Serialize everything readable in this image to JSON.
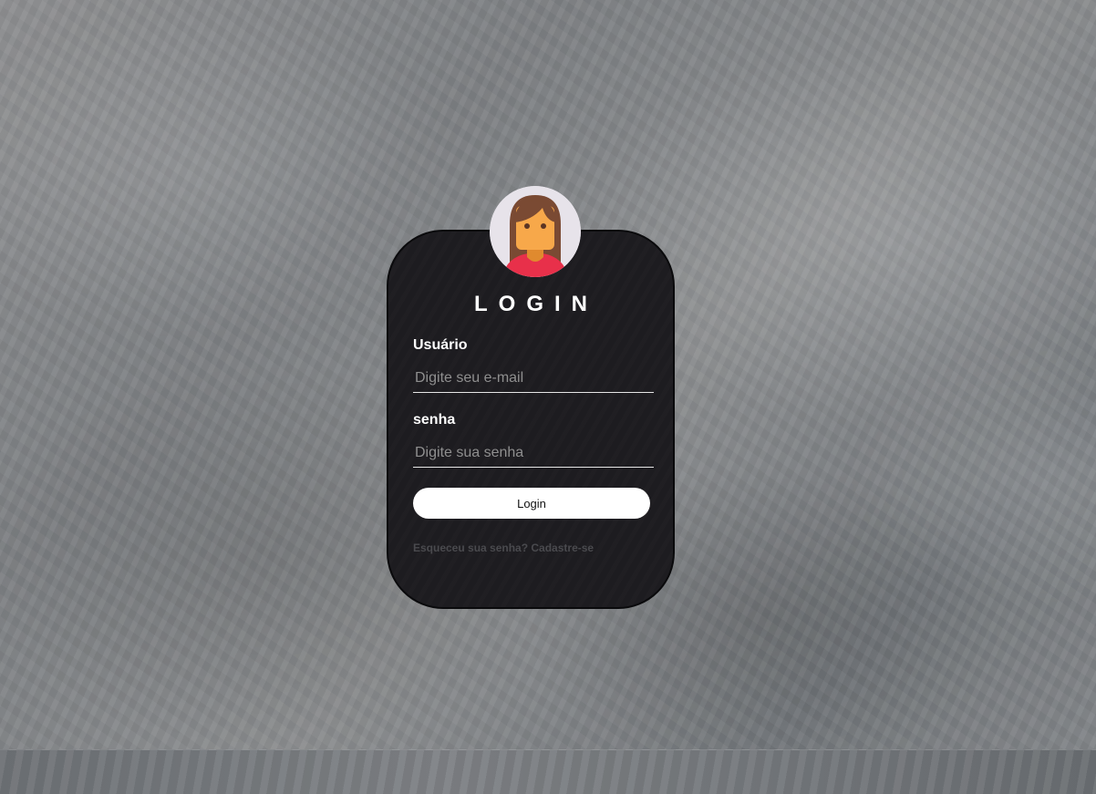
{
  "background": {
    "style": "grey concrete texture"
  },
  "login_card": {
    "avatar": {
      "icon": "female-user-avatar-icon"
    },
    "title": "LOGIN",
    "username": {
      "label": "Usuário",
      "placeholder": "Digite seu e-mail",
      "value": ""
    },
    "password": {
      "label": "senha",
      "placeholder": "Digite sua senha",
      "value": ""
    },
    "submit_label": "Login",
    "forgot_password_link": "Esqueceu sua senha?",
    "signup_link": "Cadastre-se"
  },
  "colors": {
    "card_background": "#1d1c20",
    "button_background": "#ffffff",
    "link_color": "#4a4a4e",
    "avatar_skin": "#f7a84a",
    "avatar_hair": "#7a4a33",
    "avatar_shirt": "#e8304a"
  }
}
